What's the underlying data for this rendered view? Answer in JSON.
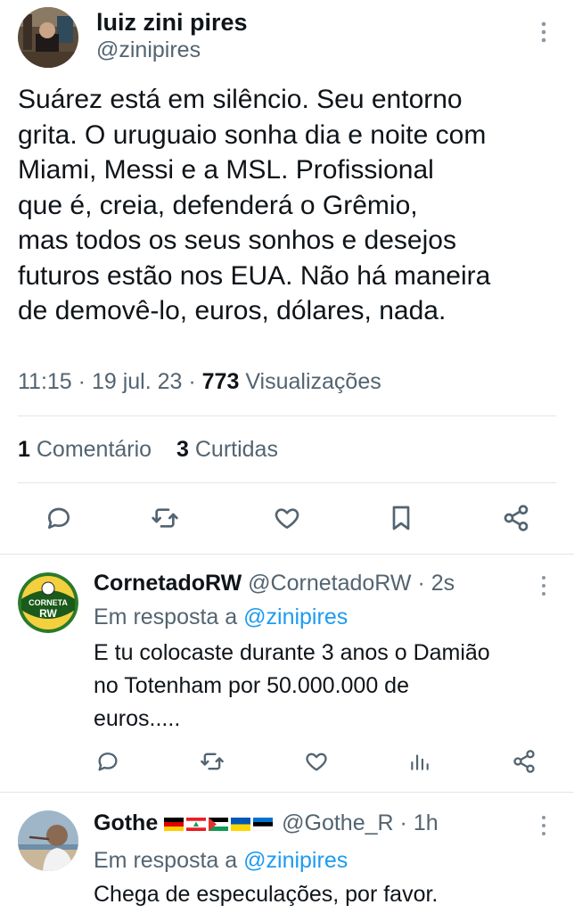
{
  "main_tweet": {
    "author_name": "luiz zini pires",
    "author_handle": "@zinipires",
    "text": "Suárez está em silêncio. Seu entorno\ngrita. O uruguaio sonha dia e noite com\nMiami, Messi e a MSL. Profissional\nque é, creia, defenderá o Grêmio,\nmas todos os seus sonhos e desejos\nfuturos estão nos EUA. Não há maneira\nde demovê-lo, euros, dólares, nada.",
    "time": "11:15",
    "date": "19 jul. 23",
    "views_count": "773",
    "views_label": "Visualizações",
    "comments_count": "1",
    "comments_label": "Comentário",
    "likes_count": "3",
    "likes_label": "Curtidas",
    "actions": [
      "reply-icon",
      "retweet-icon",
      "like-icon",
      "bookmark-icon",
      "share-icon"
    ]
  },
  "replies": [
    {
      "name": "CornetadoRW",
      "handle": "@CornetadoRW",
      "age": "2s",
      "replying_prefix": "Em resposta a",
      "replying_to": "@zinipires",
      "text": "E tu colocaste durante 3 anos o Damião\nno Totenham por 50.000.000 de\neuros.....",
      "avatar_text": "CORNETA RW",
      "actions": [
        "reply-icon",
        "retweet-icon",
        "like-icon",
        "views-icon",
        "share-icon"
      ]
    },
    {
      "name": "Gothe",
      "flags": [
        "germany-flag",
        "lebanon-flag",
        "palestine-flag",
        "ukraine-flag",
        "estonia-flag"
      ],
      "handle": "@Gothe_R",
      "age": "1h",
      "replying_prefix": "Em resposta a",
      "replying_to": "@zinipires",
      "text": "Chega de especulações, por favor."
    }
  ],
  "colors": {
    "text": "#0f1419",
    "secondary": "#536471",
    "accent": "#1d9bf0",
    "divider": "#e1e6ea"
  }
}
